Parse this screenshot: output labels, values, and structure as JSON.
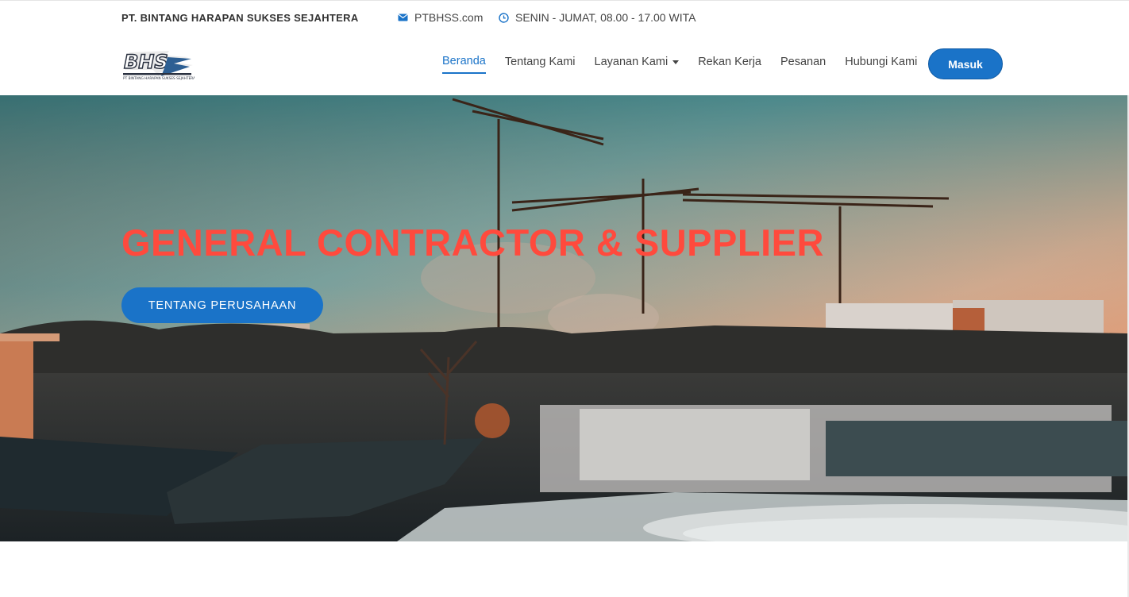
{
  "topbar": {
    "company": "PT. BINTANG HARAPAN SUKSES SEJAHTERA",
    "email": "PTBHSS.com",
    "hours": "SENIN - JUMAT, 08.00 - 17.00 WITA",
    "email_icon": "mail-icon",
    "hours_icon": "clock-icon"
  },
  "logo": {
    "text": "BHS",
    "subtext": "PT BINTANG HARAPAN SUKSES SEJAHTERA"
  },
  "nav": {
    "items": [
      {
        "label": "Beranda",
        "active": true
      },
      {
        "label": "Tentang Kami"
      },
      {
        "label": "Layanan Kami",
        "dropdown": true
      },
      {
        "label": "Rekan Kerja"
      },
      {
        "label": "Pesanan"
      },
      {
        "label": "Hubungi Kami"
      }
    ],
    "login_label": "Masuk"
  },
  "hero": {
    "title": "GENERAL CONTRACTOR & SUPPLIER",
    "button_label": "TENTANG PERUSAHAAN"
  },
  "colors": {
    "accent": "#1a73c8",
    "hero_title": "#ff4a3d"
  }
}
